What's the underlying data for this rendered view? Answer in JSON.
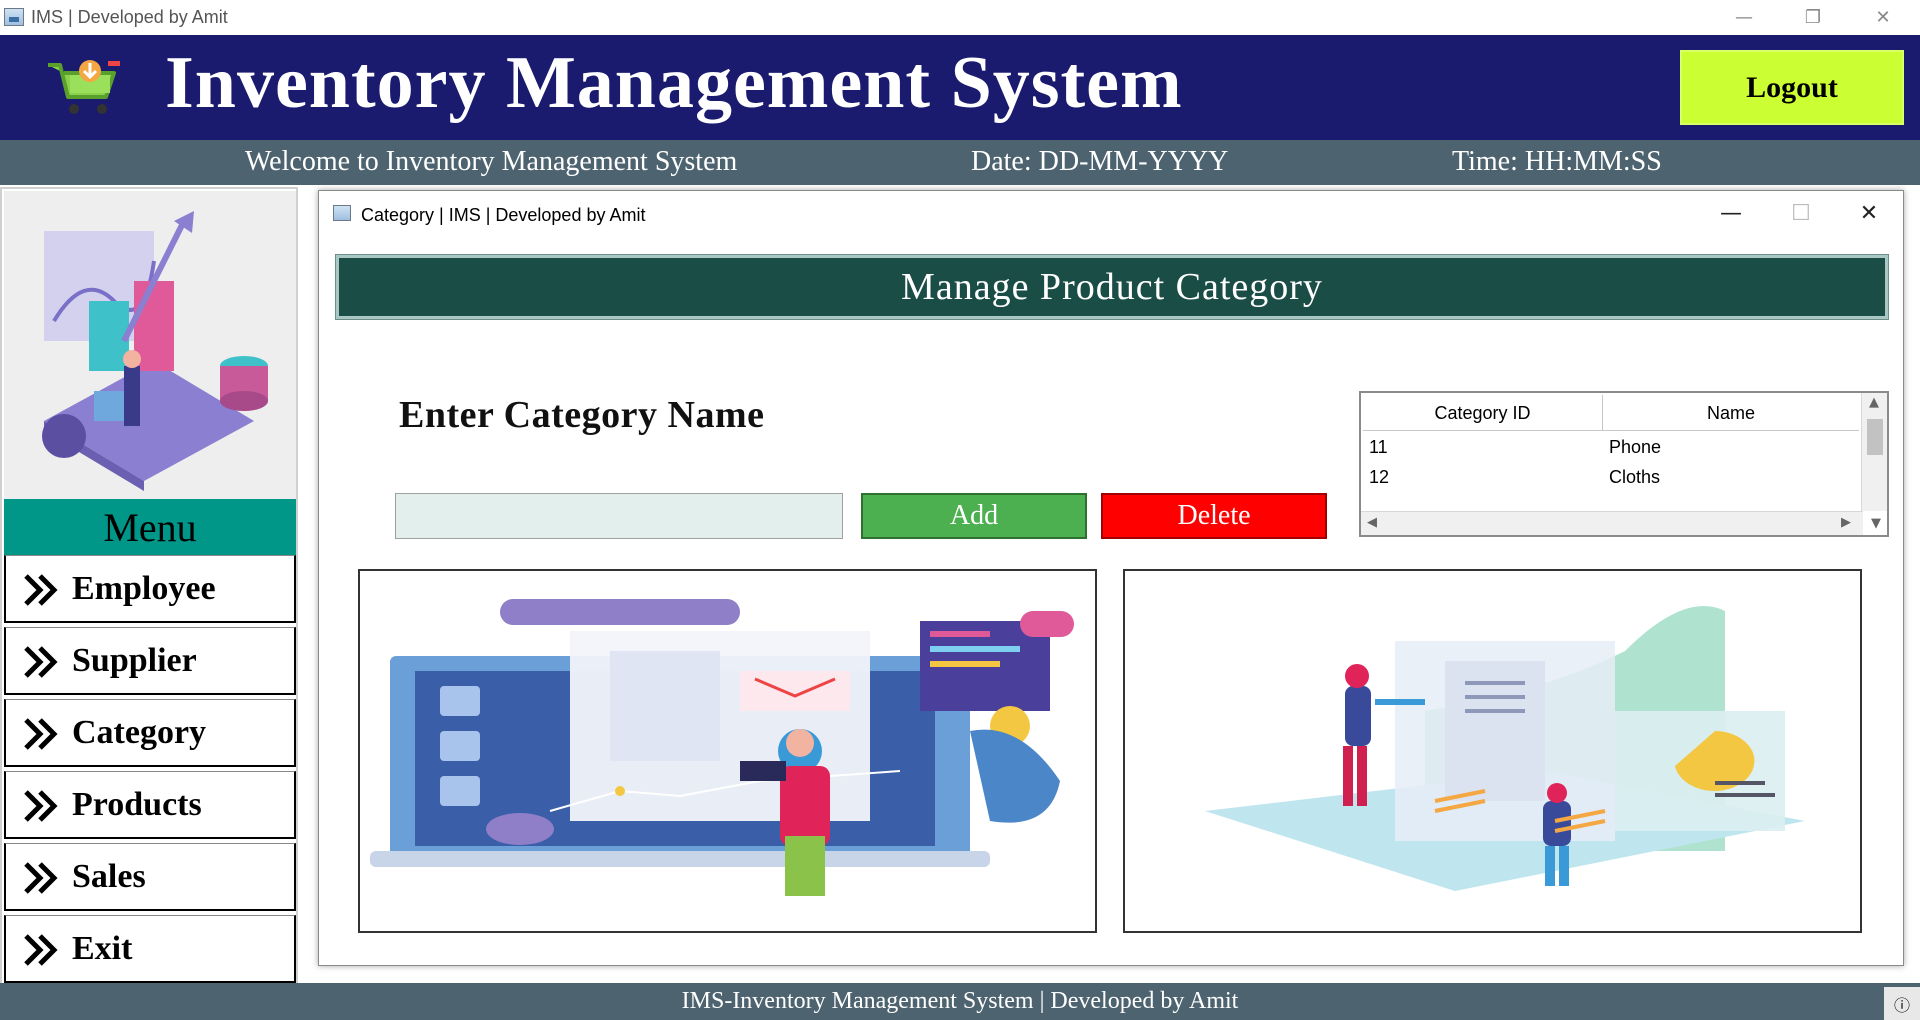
{
  "window": {
    "title": "IMS | Developed by Amit",
    "minimize": "—",
    "restore": "❐",
    "close": "✕"
  },
  "header": {
    "title": "Inventory Management System",
    "logout_label": "Logout",
    "accent_color": "#1a1a6e",
    "logout_color": "#ccff33"
  },
  "welcome_bar": {
    "welcome": "Welcome to Inventory Management System",
    "date": "Date: DD-MM-YYYY",
    "time": "Time: HH:MM:SS"
  },
  "menu": {
    "title": "Menu",
    "items": [
      {
        "label": "Employee"
      },
      {
        "label": "Supplier"
      },
      {
        "label": "Category"
      },
      {
        "label": "Products"
      },
      {
        "label": "Sales"
      },
      {
        "label": "Exit"
      }
    ]
  },
  "category_window": {
    "title": "Category | IMS | Developed by Amit",
    "heading": "Manage Product Category",
    "enter_label": "Enter Category Name",
    "input_value": "",
    "add_label": "Add",
    "delete_label": "Delete",
    "table": {
      "columns": [
        "Category ID",
        "Name"
      ],
      "rows": [
        [
          "11",
          "Phone"
        ],
        [
          "12",
          "Cloths"
        ]
      ]
    }
  },
  "footer": {
    "text": "IMS-Inventory Management System | Developed by Amit",
    "info_icon": "ⓘ"
  }
}
